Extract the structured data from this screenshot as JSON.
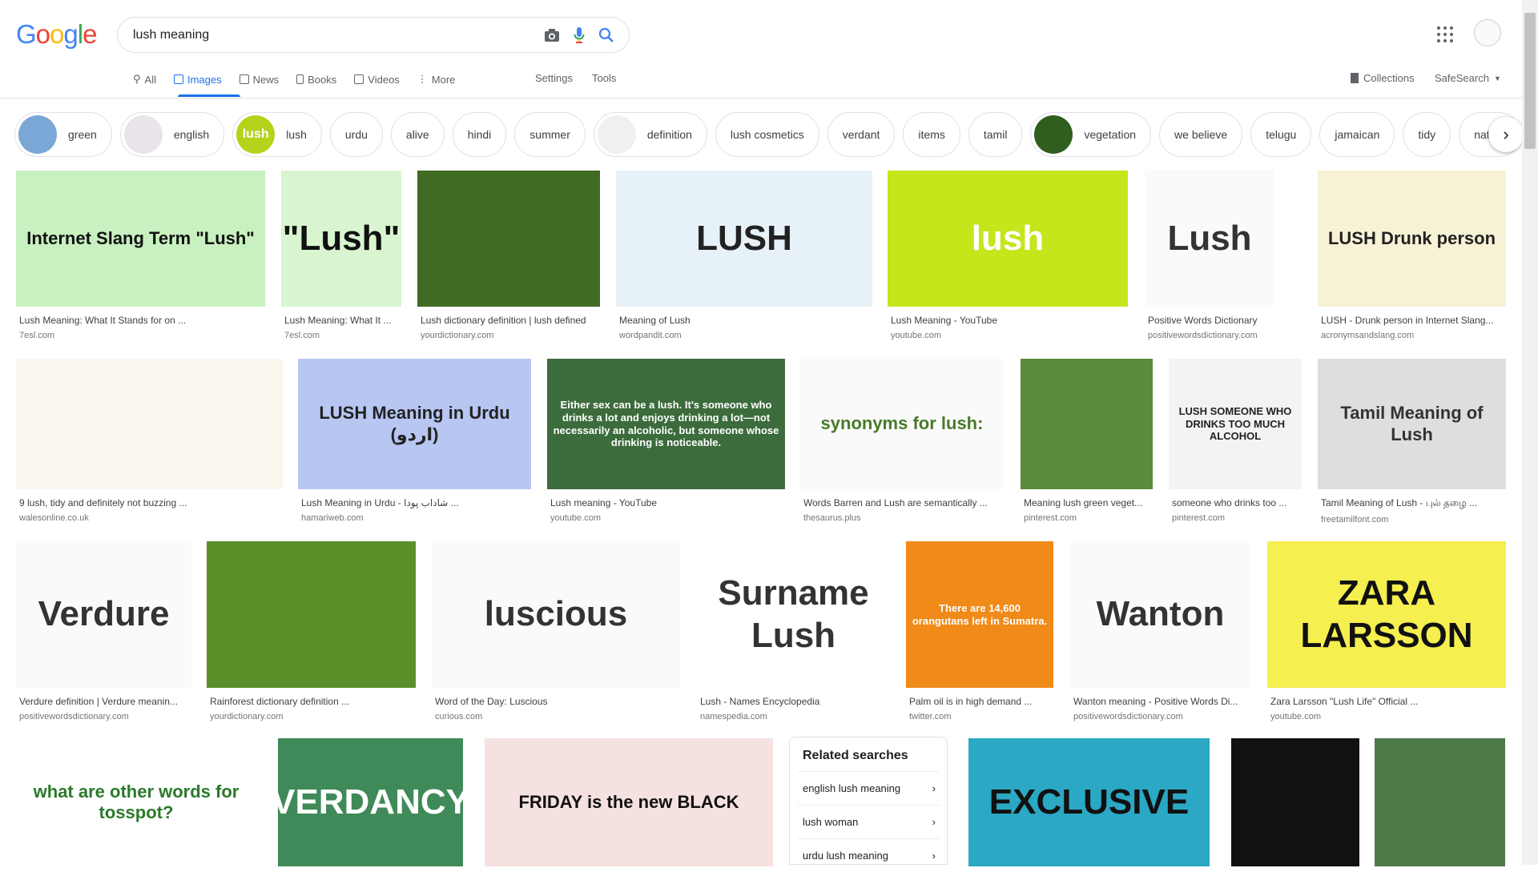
{
  "search": {
    "query": "lush meaning"
  },
  "logo": [
    "G",
    "o",
    "o",
    "g",
    "l",
    "e"
  ],
  "tabs": [
    {
      "label": "All",
      "icon": "search-icon"
    },
    {
      "label": "Images",
      "icon": "image-icon"
    },
    {
      "label": "News",
      "icon": "news-icon"
    },
    {
      "label": "Books",
      "icon": "book-icon"
    },
    {
      "label": "Videos",
      "icon": "play-icon"
    },
    {
      "label": "More",
      "icon": "more-vert-icon"
    }
  ],
  "settings_label": "Settings",
  "tools_label": "Tools",
  "collections_label": "Collections",
  "safesearch_label": "SafeSearch",
  "chips": [
    {
      "label": "green",
      "thumb": "#7aa7d6"
    },
    {
      "label": "english",
      "thumb": "#e8e4ea"
    },
    {
      "label": "lush",
      "thumb": "#b7d21c",
      "text_thumb": "lush"
    },
    {
      "label": "urdu"
    },
    {
      "label": "alive"
    },
    {
      "label": "hindi"
    },
    {
      "label": "summer"
    },
    {
      "label": "definition",
      "thumb": "#f0f0f0"
    },
    {
      "label": "lush cosmetics"
    },
    {
      "label": "verdant"
    },
    {
      "label": "items"
    },
    {
      "label": "tamil"
    },
    {
      "label": "vegetation",
      "thumb": "#2f5e1e"
    },
    {
      "label": "we believe"
    },
    {
      "label": "telugu"
    },
    {
      "label": "jamaican"
    },
    {
      "label": "tidy"
    },
    {
      "label": "nature"
    }
  ],
  "results": [
    {
      "caption": "Lush Meaning: What It Stands for on ...",
      "source": "7esl.com",
      "img_text": "Internet Slang Term  \"Lush\"",
      "color": "#c8f0c0",
      "fg": "#111"
    },
    {
      "caption": "Lush Meaning: What It ...",
      "source": "7esl.com",
      "img_text": "\"Lush\"",
      "color": "#d8f5d0",
      "fg": "#111"
    },
    {
      "caption": "Lush dictionary definition | lush defined",
      "source": "yourdictionary.com",
      "img_text": "",
      "color": "#3f6b22",
      "fg": "#fff"
    },
    {
      "caption": "Meaning of Lush",
      "source": "wordpandit.com",
      "img_text": "LUSH",
      "color": "#e6f1f8",
      "fg": "#222"
    },
    {
      "caption": "Lush Meaning - YouTube",
      "source": "youtube.com",
      "img_text": "lush",
      "color": "#c6e51b",
      "fg": "#fff"
    },
    {
      "caption": "Positive Words Dictionary",
      "source": "positivewordsdictionary.com",
      "img_text": "Lush",
      "color": "#fafafa",
      "fg": "#333"
    },
    {
      "caption": "LUSH - Drunk person in Internet Slang...",
      "source": "acronymsandslang.com",
      "img_text": "LUSH  Drunk person",
      "color": "#f7f2d6",
      "fg": "#222"
    },
    {
      "caption": "9 lush, tidy and definitely not buzzing ...",
      "source": "walesonline.co.uk",
      "img_text": "",
      "color": "#faf6ee",
      "fg": "#a06a00"
    },
    {
      "caption": "Lush Meaning in Urdu - شاداب پودا ...",
      "source": "hamariweb.com",
      "img_text": "LUSH  Meaning in Urdu (اردو)",
      "color": "#b8c6f2",
      "fg": "#222"
    },
    {
      "caption": "Lush meaning - YouTube",
      "source": "youtube.com",
      "img_text": "Either sex can be a lush. It's someone who drinks a lot and enjoys drinking a lot—not necessarily an alcoholic, but someone whose drinking is noticeable.",
      "color": "#3c6b3c",
      "fg": "#fff"
    },
    {
      "caption": "Words Barren and Lush are semantically ...",
      "source": "thesaurus.plus",
      "img_text": "synonyms for lush:",
      "color": "#fafafa",
      "fg": "#4a7a2a"
    },
    {
      "caption": "Meaning lush green veget...",
      "source": "pinterest.com",
      "img_text": "",
      "color": "#5a8a3a",
      "fg": "#fff"
    },
    {
      "caption": "someone who drinks too ...",
      "source": "pinterest.com",
      "img_text": "LUSH  SOMEONE WHO DRINKS TOO MUCH ALCOHOL",
      "color": "#f3f3f3",
      "fg": "#222"
    },
    {
      "caption": "Tamil Meaning of Lush - புல் தழை ...",
      "source": "freetamilfont.com",
      "img_text": "Tamil Meaning of Lush",
      "color": "#dedede",
      "fg": "#333"
    },
    {
      "caption": "Verdure definition | Verdure meanin...",
      "source": "positivewordsdictionary.com",
      "img_text": "Verdure",
      "color": "#fafafa",
      "fg": "#333"
    },
    {
      "caption": "Rainforest dictionary definition ...",
      "source": "yourdictionary.com",
      "img_text": "",
      "color": "#5b8f2a",
      "fg": "#fff"
    },
    {
      "caption": "Word of the Day: Luscious",
      "source": "curious.com",
      "img_text": "luscious",
      "color": "#fafafa",
      "fg": "#333"
    },
    {
      "caption": "Lush - Names Encyclopedia",
      "source": "namespedia.com",
      "img_text": "Surname Lush",
      "color": "#ffffff",
      "fg": "#333"
    },
    {
      "caption": "Palm oil is in high demand ...",
      "source": "twitter.com",
      "img_text": "There are 14,600 orangutans left in Sumatra.",
      "color": "#f08a18",
      "fg": "#fff"
    },
    {
      "caption": "Wanton meaning - Positive Words Di...",
      "source": "positivewordsdictionary.com",
      "img_text": "Wanton",
      "color": "#fafafa",
      "fg": "#333"
    },
    {
      "caption": "Zara Larsson \"Lush Life\" Official ...",
      "source": "youtube.com",
      "img_text": "ZARA LARSSON",
      "color": "#f5ef50",
      "fg": "#111"
    },
    {
      "caption": "",
      "source": "",
      "img_text": "what are other words for tosspot?",
      "color": "#ffffff",
      "fg": "#2a7a2a"
    },
    {
      "caption": "",
      "source": "",
      "img_text": "VERDANCY",
      "color": "#3f8a58",
      "fg": "#fff"
    },
    {
      "caption": "",
      "source": "",
      "img_text": "FRIDAY is the new BLACK",
      "color": "#f6e1e1",
      "fg": "#111"
    },
    {
      "caption": "",
      "source": "",
      "img_text": "EXCLUSIVE",
      "color": "#2aa8c4",
      "fg": "#111"
    },
    {
      "caption": "",
      "source": "",
      "img_text": "",
      "color": "#111111",
      "fg": "#fff"
    },
    {
      "caption": "",
      "source": "",
      "img_text": "",
      "color": "#4e7a4a",
      "fg": "#fff"
    }
  ],
  "related": {
    "title": "Related searches",
    "items": [
      "english lush meaning",
      "lush woman",
      "urdu lush meaning"
    ]
  },
  "colors": {
    "accent": "#1a73e8",
    "text": "#202124",
    "muted": "#70757a"
  }
}
